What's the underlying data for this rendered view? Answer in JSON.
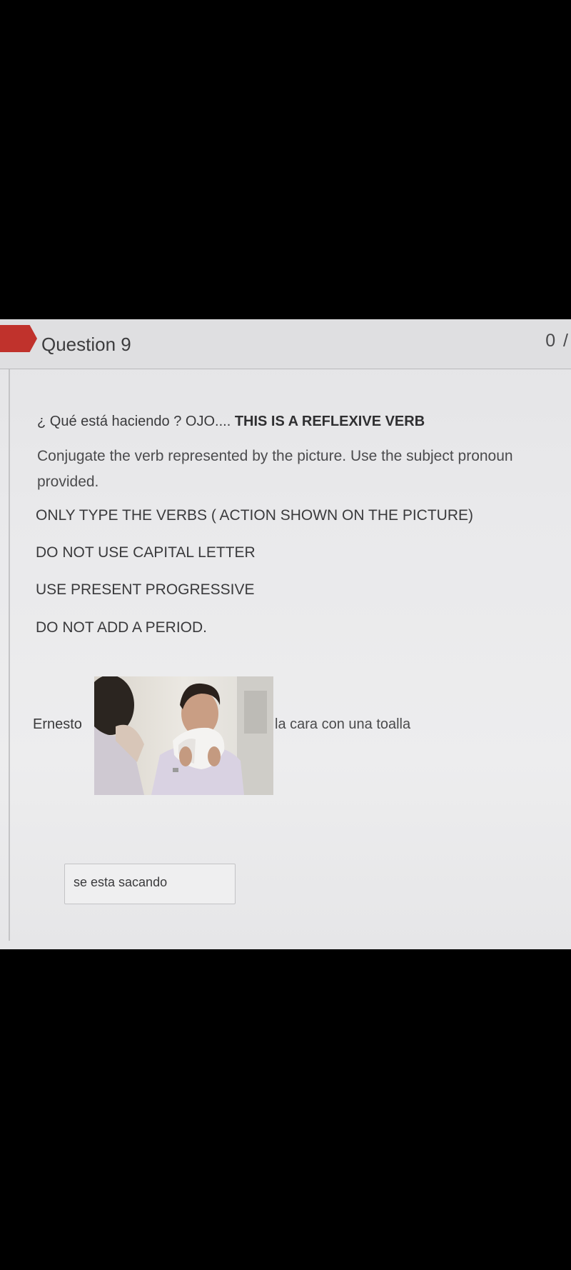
{
  "question": {
    "title": "Question 9",
    "points": "0 /"
  },
  "prompt": {
    "line1_plain": "¿ Qué está haciendo ?   OJO.... ",
    "line1_bold": "THIS IS A REFLEXIVE VERB",
    "line2": "Conjugate the verb represented by the picture. Use the subject pronoun",
    "line3": "provided.",
    "rule1": "ONLY TYPE THE VERBS ( ACTION SHOWN ON THE PICTURE)",
    "rule2": "DO NOT USE CAPITAL LETTER",
    "rule3": "USE PRESENT PROGRESSIVE",
    "rule4": "DO NOT ADD A PERIOD."
  },
  "sentence": {
    "subject": "Ernesto",
    "rest": "la cara con una toalla"
  },
  "answer": {
    "value": "se esta sacando"
  },
  "colors": {
    "flag": "#c0322c",
    "background": "#e9e9eb",
    "text": "#3a3a3c"
  }
}
